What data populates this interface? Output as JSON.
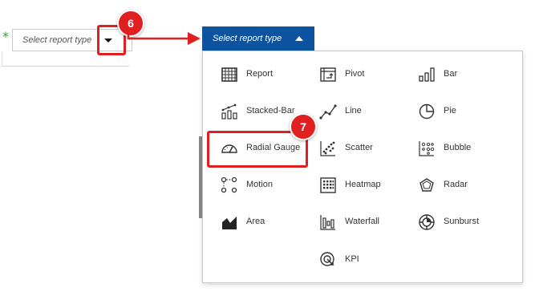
{
  "field": {
    "required_marker": "*",
    "placeholder": "Select report type"
  },
  "dropdown": {
    "button_label": "Select report type",
    "options": [
      {
        "label": "Report",
        "icon": "grid-icon"
      },
      {
        "label": "Pivot",
        "icon": "pivot-icon"
      },
      {
        "label": "Bar",
        "icon": "bar-chart-icon"
      },
      {
        "label": "Stacked-Bar",
        "icon": "stacked-bar-icon"
      },
      {
        "label": "Line",
        "icon": "line-chart-icon"
      },
      {
        "label": "Pie",
        "icon": "pie-chart-icon"
      },
      {
        "label": "Radial Gauge",
        "icon": "gauge-icon"
      },
      {
        "label": "Scatter",
        "icon": "scatter-icon"
      },
      {
        "label": "Bubble",
        "icon": "bubble-icon"
      },
      {
        "label": "Motion",
        "icon": "motion-icon"
      },
      {
        "label": "Heatmap",
        "icon": "heatmap-icon"
      },
      {
        "label": "Radar",
        "icon": "radar-icon"
      },
      {
        "label": "Area",
        "icon": "area-chart-icon"
      },
      {
        "label": "Waterfall",
        "icon": "waterfall-icon"
      },
      {
        "label": "Sunburst",
        "icon": "sunburst-icon"
      },
      {
        "label": "KPI",
        "icon": "kpi-icon"
      }
    ]
  },
  "annotations": {
    "step_a": "6",
    "step_b": "7",
    "highlight_color": "#e02020",
    "accent_color": "#0c54a0"
  }
}
